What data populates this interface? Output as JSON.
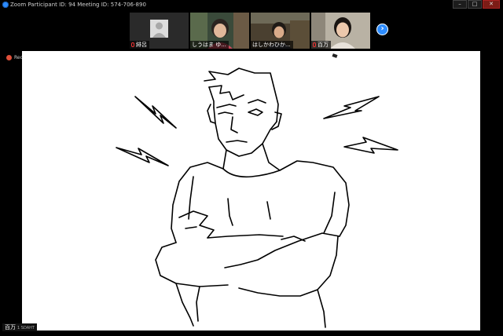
{
  "window": {
    "title": "Zoom Participant ID: 94   Meeting ID: 574-706-890",
    "buttons": {
      "minimize": "–",
      "maximize": "□",
      "close": "✕"
    }
  },
  "participants": [
    {
      "name": "緋呂",
      "muted": true,
      "video": false
    },
    {
      "name": "しうはま ゆ...",
      "muted": false,
      "video": true
    },
    {
      "name": "はしかわひか...",
      "muted": false,
      "video": true
    },
    {
      "name": "百万",
      "muted": true,
      "video": true
    }
  ],
  "next_label": "›",
  "recording_label": "Rec",
  "active_speaker": {
    "name": "百万",
    "tag": "1 SDAHT"
  },
  "colors": {
    "accent": "#2d8cff",
    "record": "#e0503a",
    "background": "#000000"
  }
}
